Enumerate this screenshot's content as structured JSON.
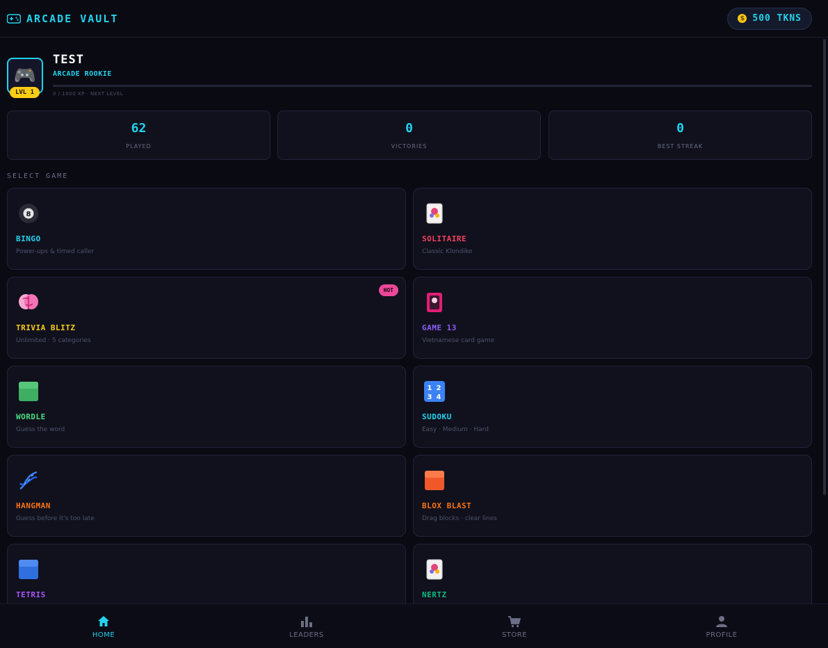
{
  "header": {
    "brand_title": "ARCADE VAULT",
    "brand_icon": "gamepad-icon",
    "tokens_label": "500 TKNS",
    "coin_icon": "$"
  },
  "profile": {
    "avatar_icon": "🎮",
    "level_badge": "LVL 1",
    "username": "TEST",
    "rank": "ARCADE ROOKIE",
    "xp_text": "0 / 1000 XP · NEXT LEVEL",
    "xp_progress": 0
  },
  "stats": [
    {
      "value": "62",
      "label": "PLAYED"
    },
    {
      "value": "0",
      "label": "VICTORIES"
    },
    {
      "value": "0",
      "label": "BEST STREAK"
    }
  ],
  "section_title": "SELECT GAME",
  "games": [
    {
      "name": "BINGO",
      "subtitle": "Power-ups & timed caller",
      "icon": "pool-8-ball-icon",
      "color": "#22d3ee"
    },
    {
      "name": "SOLITAIRE",
      "subtitle": "Classic Klondike",
      "icon": "joker-card-icon",
      "color": "#f43f5e"
    },
    {
      "name": "TRIVIA BLITZ",
      "subtitle": "Unlimited · 5 categories",
      "icon": "brain-icon",
      "color": "#facc15",
      "badge": "HOT"
    },
    {
      "name": "GAME 13",
      "subtitle": "Vietnamese card game",
      "icon": "flower-card-icon",
      "color": "#8b5cf6"
    },
    {
      "name": "WORDLE",
      "subtitle": "Guess the word",
      "icon": "green-square-icon",
      "color": "#4ade80"
    },
    {
      "name": "SUDOKU",
      "subtitle": "Easy · Medium · Hard",
      "icon": "number-keycap-icon",
      "color": "#22d3ee"
    },
    {
      "name": "HANGMAN",
      "subtitle": "Guess before it's too late",
      "icon": "dna-icon",
      "color": "#f97316"
    },
    {
      "name": "BLOX BLAST",
      "subtitle": "Drag blocks · clear lines",
      "icon": "orange-square-icon",
      "color": "#f97316"
    },
    {
      "name": "TETRIS",
      "subtitle": "",
      "icon": "blue-square-icon",
      "color": "#a855f7"
    },
    {
      "name": "NERTZ",
      "subtitle": "",
      "icon": "joker-card-icon",
      "color": "#10b981"
    }
  ],
  "nav": [
    {
      "label": "HOME",
      "icon": "home-icon",
      "active": true
    },
    {
      "label": "LEADERS",
      "icon": "bar-chart-icon",
      "active": false
    },
    {
      "label": "STORE",
      "icon": "cart-icon",
      "active": false
    },
    {
      "label": "PROFILE",
      "icon": "person-icon",
      "active": false
    }
  ],
  "colors": {
    "accent": "#22d3ee",
    "background": "#0a0a13",
    "card": "#10111d",
    "inactive_nav": "#6b6f86",
    "level_badge": "#facc15",
    "hot_badge": "#ec4899"
  }
}
